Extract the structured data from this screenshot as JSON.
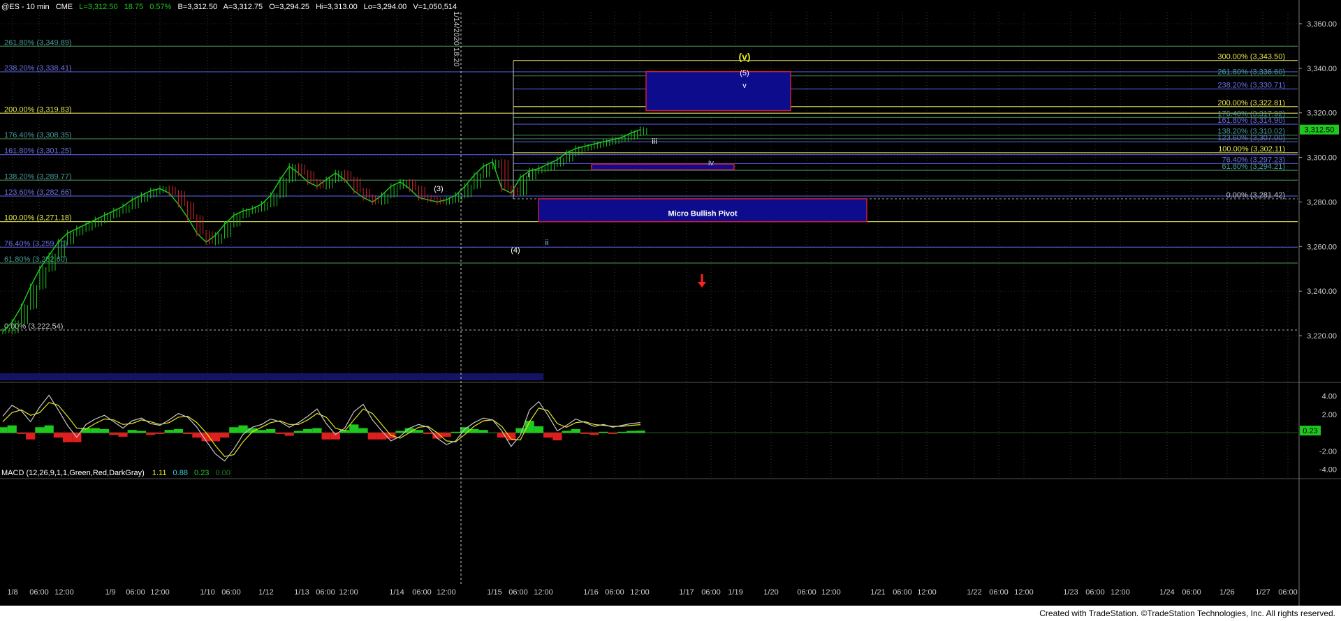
{
  "header": {
    "symbol": "@ES - 10 min",
    "exchange": "CME",
    "last": "L=3,312.50",
    "change": "18.75",
    "pct": "0.57%",
    "bid": "B=3,312.50",
    "ask": "A=3,312.75",
    "open": "O=3,294.25",
    "high": "Hi=3,313.00",
    "low": "Lo=3,294.00",
    "volume": "V=1,050,514"
  },
  "macd_header": {
    "label": "MACD (12,26,9,1,1,Green,Red,DarkGray)",
    "v1": "1.11",
    "v2": "0.88",
    "v3": "0.23",
    "v4": "0.00"
  },
  "footer": "Created with TradeStation. ©TradeStation Technologies, Inc. All rights reserved.",
  "vline_label": "1/14/2020 18:20",
  "colors": {
    "blue_line": "#4f52c8",
    "yellow_line": "#c8c85a",
    "green_line": "#3c7a4c",
    "price_green": "#1ec81e",
    "price_red": "#d22828",
    "zone_fill": "#0c0c8c",
    "zone_border": "#c81e3c"
  },
  "chart_data": {
    "type": "line",
    "title": "@ES - 10 min",
    "xlabel": "",
    "ylabel": "",
    "ylim": [
      3200,
      3365
    ],
    "y_ticks": [
      "3,360.00",
      "3,340.00",
      "3,320.00",
      "3,300.00",
      "3,280.00",
      "3,260.00",
      "3,240.00",
      "3,220.00"
    ],
    "y_tick_values": [
      3360,
      3340,
      3320,
      3300,
      3280,
      3260,
      3240,
      3220
    ],
    "x_ticks": [
      "1/8",
      "06:00",
      "12:00",
      "1/9",
      "06:00",
      "12:00",
      "1/10",
      "06:00",
      "1/12",
      "1/13",
      "06:00",
      "12:00",
      "1/14",
      "06:00",
      "12:00",
      "1/15",
      "06:00",
      "12:00",
      "1/16",
      "06:00",
      "12:00",
      "1/17",
      "06:00",
      "1/19",
      "1/20",
      "06:00",
      "12:00",
      "1/21",
      "06:00",
      "12:00",
      "1/22",
      "06:00",
      "12:00",
      "1/23",
      "06:00",
      "12:00",
      "1/24",
      "06:00",
      "1/26",
      "1/27",
      "06:00"
    ],
    "last_price_label": "3,312.50",
    "left_fibs": [
      {
        "label": "261.80% (3,349.89)",
        "value": 3349.89,
        "color": "green"
      },
      {
        "label": "238.20% (3,338.41)",
        "value": 3338.41,
        "color": "blue"
      },
      {
        "label": "200.00% (3,319.83)",
        "value": 3319.83,
        "color": "yellow"
      },
      {
        "label": "176.40% (3,308.35)",
        "value": 3308.35,
        "color": "green"
      },
      {
        "label": "161.80% (3,301.25)",
        "value": 3301.25,
        "color": "blue"
      },
      {
        "label": "138.20% (3,289.77)",
        "value": 3289.77,
        "color": "green"
      },
      {
        "label": "123.60% (3,282.66)",
        "value": 3282.66,
        "color": "blue"
      },
      {
        "label": "100.00% (3,271.18)",
        "value": 3271.18,
        "color": "yellow"
      },
      {
        "label": "76.40% (3,259.70)",
        "value": 3259.7,
        "color": "blue"
      },
      {
        "label": "61.80% (3,252.60)",
        "value": 3252.6,
        "color": "green"
      },
      {
        "label": "0.00% (3,222.54)",
        "value": 3222.54,
        "color": "gray"
      }
    ],
    "right_fibs": [
      {
        "label": "300.00% (3,343.50)",
        "value": 3343.5,
        "color": "yellow"
      },
      {
        "label": "261.80% (3,336.60)",
        "value": 3336.6,
        "color": "green"
      },
      {
        "label": "238.20% (3,330.71)",
        "value": 3330.71,
        "color": "blue"
      },
      {
        "label": "200.00% (3,322.81)",
        "value": 3322.81,
        "color": "yellow"
      },
      {
        "label": "176.40% (3,317.92)",
        "value": 3317.92,
        "color": "green"
      },
      {
        "label": "161.80% (3,314.90)",
        "value": 3314.9,
        "color": "blue"
      },
      {
        "label": "138.20% (3,310.02)",
        "value": 3310.02,
        "color": "green"
      },
      {
        "label": "123.60% (3,307.00)",
        "value": 3307.0,
        "color": "blue"
      },
      {
        "label": "100.00% (3,302.11)",
        "value": 3302.11,
        "color": "yellow"
      },
      {
        "label": "76.40% (3,297.23)",
        "value": 3297.23,
        "color": "blue"
      },
      {
        "label": "61.80% (3,294.21)",
        "value": 3294.21,
        "color": "green"
      },
      {
        "label": "0.00% (3,281.42)",
        "value": 3281.42,
        "color": "gray"
      }
    ],
    "zones": [
      {
        "label": "",
        "y_top": 3338.5,
        "y_bottom": 3321.0
      },
      {
        "label": "",
        "y_top": 3297.0,
        "y_bottom": 3294.5
      },
      {
        "label": "Micro Bullish Pivot",
        "y_top": 3281.42,
        "y_bottom": 3271.18
      }
    ],
    "wave_labels": [
      "(v)",
      "(5)",
      "v",
      "iii",
      "iv",
      "i",
      "ii",
      "(3)",
      "(4)"
    ],
    "price_path": [
      3222,
      3226,
      3233,
      3242,
      3250,
      3256,
      3262,
      3266,
      3268,
      3270,
      3272,
      3274,
      3276,
      3278,
      3281,
      3283,
      3285,
      3286,
      3284,
      3279,
      3273,
      3266,
      3262,
      3265,
      3270,
      3274,
      3276,
      3277,
      3279,
      3283,
      3290,
      3296,
      3293,
      3289,
      3287,
      3290,
      3293,
      3290,
      3285,
      3282,
      3280,
      3283,
      3287,
      3289,
      3286,
      3282,
      3281,
      3280,
      3281,
      3283,
      3287,
      3292,
      3296,
      3298,
      3286,
      3284,
      3291,
      3294,
      3295,
      3297,
      3299,
      3302,
      3304,
      3305,
      3306,
      3307,
      3308,
      3309,
      3311,
      3312.5
    ],
    "macd": {
      "ylim": [
        -4.8,
        5.2
      ],
      "y_ticks": [
        "4.00",
        "2.00",
        "-2.00",
        "-4.00"
      ],
      "y_tick_values": [
        4,
        2,
        -2,
        -4
      ],
      "current_label": "0.23",
      "macd_line": [
        1.8,
        3.0,
        2.4,
        1.2,
        2.8,
        4.1,
        2.5,
        0.8,
        -0.5,
        0.9,
        1.5,
        1.9,
        1.2,
        0.5,
        1.3,
        1.6,
        1.0,
        0.8,
        1.4,
        2.1,
        1.7,
        0.6,
        -0.9,
        -2.3,
        -3.1,
        -1.8,
        -0.2,
        0.6,
        0.9,
        1.5,
        1.2,
        0.6,
        1.1,
        1.8,
        2.6,
        1.0,
        -0.2,
        0.5,
        2.3,
        3.1,
        1.4,
        0.2,
        -0.9,
        -0.4,
        0.5,
        0.9,
        0.6,
        -0.6,
        -1.3,
        -0.9,
        0.4,
        1.1,
        1.6,
        1.4,
        0.2,
        -1.5,
        -0.3,
        2.5,
        3.4,
        1.9,
        0.2,
        0.8,
        1.5,
        1.1,
        0.7,
        0.9,
        0.6,
        0.8,
        1.0,
        1.11
      ],
      "signal_line": [
        1.2,
        2.2,
        2.5,
        1.9,
        2.2,
        3.3,
        3.0,
        1.8,
        0.5,
        0.4,
        1.0,
        1.5,
        1.4,
        0.9,
        1.0,
        1.4,
        1.2,
        0.9,
        1.1,
        1.7,
        1.8,
        1.1,
        0.0,
        -1.4,
        -2.6,
        -2.4,
        -1.0,
        0.1,
        0.6,
        1.1,
        1.3,
        0.9,
        0.9,
        1.4,
        2.1,
        1.7,
        0.5,
        0.2,
        1.4,
        2.6,
        2.1,
        0.9,
        -0.3,
        -0.6,
        0.0,
        0.6,
        0.7,
        0.0,
        -0.9,
        -1.0,
        -0.2,
        0.7,
        1.3,
        1.4,
        0.7,
        -0.7,
        -0.8,
        1.2,
        2.7,
        2.4,
        1.0,
        0.6,
        1.1,
        1.2,
        0.9,
        0.8,
        0.7,
        0.7,
        0.8,
        0.88
      ]
    }
  }
}
